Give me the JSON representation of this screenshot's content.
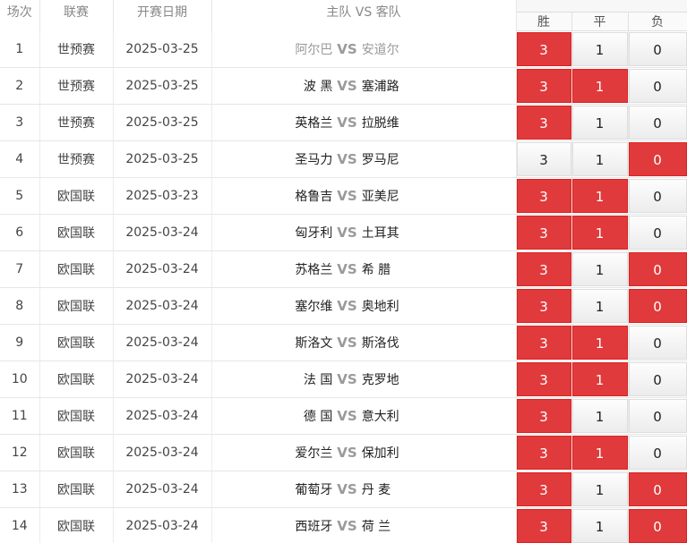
{
  "header": {
    "col_index": "场次",
    "col_league": "联赛",
    "col_date": "开赛日期",
    "col_match": "主队 VS 客队",
    "col_win": "胜",
    "col_draw": "平",
    "col_loss": "负"
  },
  "accent_color": "#e03a3c",
  "vs_label": "VS",
  "rows": [
    {
      "index": "1",
      "league": "世预赛",
      "date": "2025-03-25",
      "home": "阿尔巴",
      "away": "安道尔",
      "win": "3",
      "draw": "1",
      "loss": "0",
      "selected": [
        "win"
      ],
      "dim": true
    },
    {
      "index": "2",
      "league": "世预赛",
      "date": "2025-03-25",
      "home": "波 黑",
      "away": "塞浦路",
      "win": "3",
      "draw": "1",
      "loss": "0",
      "selected": [
        "win",
        "draw"
      ]
    },
    {
      "index": "3",
      "league": "世预赛",
      "date": "2025-03-25",
      "home": "英格兰",
      "away": "拉脱维",
      "win": "3",
      "draw": "1",
      "loss": "0",
      "selected": [
        "win"
      ]
    },
    {
      "index": "4",
      "league": "世预赛",
      "date": "2025-03-25",
      "home": "圣马力",
      "away": "罗马尼",
      "win": "3",
      "draw": "1",
      "loss": "0",
      "selected": [
        "loss"
      ]
    },
    {
      "index": "5",
      "league": "欧国联",
      "date": "2025-03-23",
      "home": "格鲁吉",
      "away": "亚美尼",
      "win": "3",
      "draw": "1",
      "loss": "0",
      "selected": [
        "win",
        "draw"
      ]
    },
    {
      "index": "6",
      "league": "欧国联",
      "date": "2025-03-24",
      "home": "匈牙利",
      "away": "土耳其",
      "win": "3",
      "draw": "1",
      "loss": "0",
      "selected": [
        "win",
        "draw"
      ]
    },
    {
      "index": "7",
      "league": "欧国联",
      "date": "2025-03-24",
      "home": "苏格兰",
      "away": "希 腊",
      "win": "3",
      "draw": "1",
      "loss": "0",
      "selected": [
        "win",
        "loss"
      ]
    },
    {
      "index": "8",
      "league": "欧国联",
      "date": "2025-03-24",
      "home": "塞尔维",
      "away": "奥地利",
      "win": "3",
      "draw": "1",
      "loss": "0",
      "selected": [
        "win",
        "loss"
      ]
    },
    {
      "index": "9",
      "league": "欧国联",
      "date": "2025-03-24",
      "home": "斯洛文",
      "away": "斯洛伐",
      "win": "3",
      "draw": "1",
      "loss": "0",
      "selected": [
        "win",
        "draw"
      ]
    },
    {
      "index": "10",
      "league": "欧国联",
      "date": "2025-03-24",
      "home": "法 国",
      "away": "克罗地",
      "win": "3",
      "draw": "1",
      "loss": "0",
      "selected": [
        "win",
        "draw"
      ]
    },
    {
      "index": "11",
      "league": "欧国联",
      "date": "2025-03-24",
      "home": "德 国",
      "away": "意大利",
      "win": "3",
      "draw": "1",
      "loss": "0",
      "selected": [
        "win"
      ]
    },
    {
      "index": "12",
      "league": "欧国联",
      "date": "2025-03-24",
      "home": "爱尔兰",
      "away": "保加利",
      "win": "3",
      "draw": "1",
      "loss": "0",
      "selected": [
        "win",
        "draw"
      ]
    },
    {
      "index": "13",
      "league": "欧国联",
      "date": "2025-03-24",
      "home": "葡萄牙",
      "away": "丹 麦",
      "win": "3",
      "draw": "1",
      "loss": "0",
      "selected": [
        "win",
        "loss"
      ]
    },
    {
      "index": "14",
      "league": "欧国联",
      "date": "2025-03-24",
      "home": "西班牙",
      "away": "荷 兰",
      "win": "3",
      "draw": "1",
      "loss": "0",
      "selected": [
        "win",
        "loss"
      ]
    }
  ]
}
